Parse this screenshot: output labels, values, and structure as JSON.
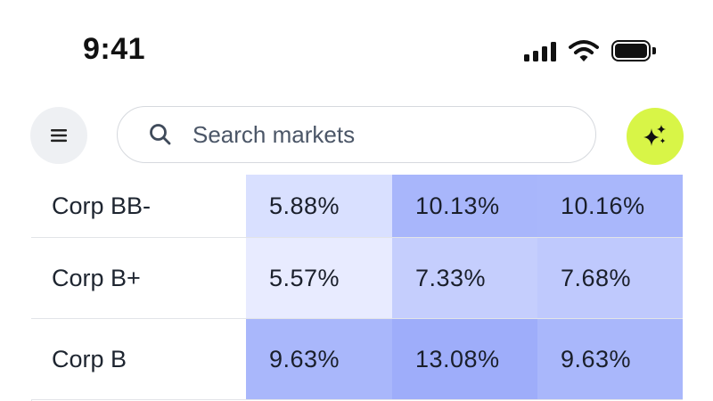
{
  "status_bar": {
    "time": "9:41",
    "icons": [
      "cellular-signal-icon",
      "wifi-icon",
      "battery-icon"
    ]
  },
  "toolbar": {
    "menu_icon": "hamburger-menu-icon",
    "search": {
      "placeholder": "Search markets",
      "value": ""
    },
    "ai_button_icon": "sparkles-icon",
    "ai_button_color": "#d8f547"
  },
  "table": {
    "rows": [
      {
        "label": "Corp BB-",
        "values": [
          "5.88%",
          "10.13%",
          "10.16%"
        ],
        "colors": [
          "#d9e0ff",
          "#a8b6fb",
          "#a9b7fb"
        ]
      },
      {
        "label": "Corp B+",
        "values": [
          "5.57%",
          "7.33%",
          "7.68%"
        ],
        "colors": [
          "#e8ebff",
          "#c5cefd",
          "#bfc9fd"
        ]
      },
      {
        "label": "Corp B",
        "values": [
          "9.63%",
          "13.08%",
          "9.63%"
        ],
        "colors": [
          "#a9b7fb",
          "#9eadfa",
          "#a9b7fb"
        ]
      }
    ]
  }
}
